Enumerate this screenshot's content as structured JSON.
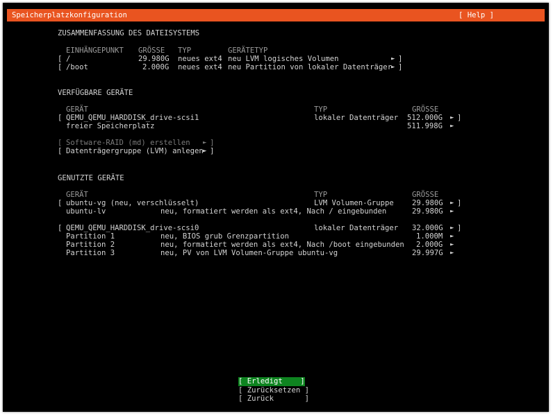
{
  "header": {
    "title": "Speicherplatzkonfiguration",
    "help": "[ Help ]"
  },
  "filesystem": {
    "heading": "ZUSAMMENFASSUNG DES DATEISYSTEMS",
    "col_mount": "EINHÄNGEPUNKT",
    "col_size": "GRÖSSE",
    "col_type": "TYP",
    "col_devtype": "GERÄTETYP",
    "rows": [
      {
        "mount": "/",
        "size": "29.980G",
        "type": "neues ext4",
        "devtype": "neu LVM logisches Volumen"
      },
      {
        "mount": "/boot",
        "size": "2.000G",
        "type": "neues ext4",
        "devtype": "neu Partition von lokaler Datenträger"
      }
    ]
  },
  "available": {
    "heading": "VERFÜGBARE GERÄTE",
    "col_device": "GERÄT",
    "col_type": "TYP",
    "col_size": "GRÖSSE",
    "disk": {
      "name": "QEMU_QEMU_HARDDISK_drive-scsi1",
      "type": "lokaler Datenträger",
      "size": "512.000G"
    },
    "free": {
      "name": "freier Speicherplatz",
      "size": "511.998G"
    },
    "raid": "Software-RAID (md) erstellen",
    "lvm": "Datenträgergruppe (LVM) anlegen"
  },
  "used": {
    "heading": "GENUTZTE GERÄTE",
    "col_device": "GERÄT",
    "col_type": "TYP",
    "col_size": "GRÖSSE",
    "vg": {
      "name": "ubuntu-vg (neu, verschlüsselt)",
      "type": "LVM Volumen-Gruppe",
      "size": "29.980G"
    },
    "lv": {
      "name": "ubuntu-lv",
      "desc": "neu, formatiert werden als ext4, Nach / eingebunden",
      "size": "29.980G"
    },
    "disk": {
      "name": "QEMU_QEMU_HARDDISK_drive-scsi0",
      "type": "lokaler Datenträger",
      "size": "32.000G"
    },
    "partitions": [
      {
        "name": "Partition 1",
        "desc": "neu, BIOS grub Grenzpartition",
        "size": "1.000M"
      },
      {
        "name": "Partition 2",
        "desc": "neu, formatiert werden als ext4, Nach /boot eingebunden",
        "size": "2.000G"
      },
      {
        "name": "Partition 3",
        "desc": "neu, PV von LVM Volumen-Gruppe ubuntu-vg",
        "size": "29.997G"
      }
    ]
  },
  "buttons": {
    "done": "[ Erledigt    ]",
    "reset": "[ Zurücksetzen ]",
    "back": "[ Zurück       ]"
  },
  "glyphs": {
    "open": "[",
    "close": "]",
    "arrow": "►"
  },
  "colors": {
    "accent": "#e95420",
    "focus": "#0e8420",
    "background": "#000000",
    "text": "#d3d3d3"
  }
}
